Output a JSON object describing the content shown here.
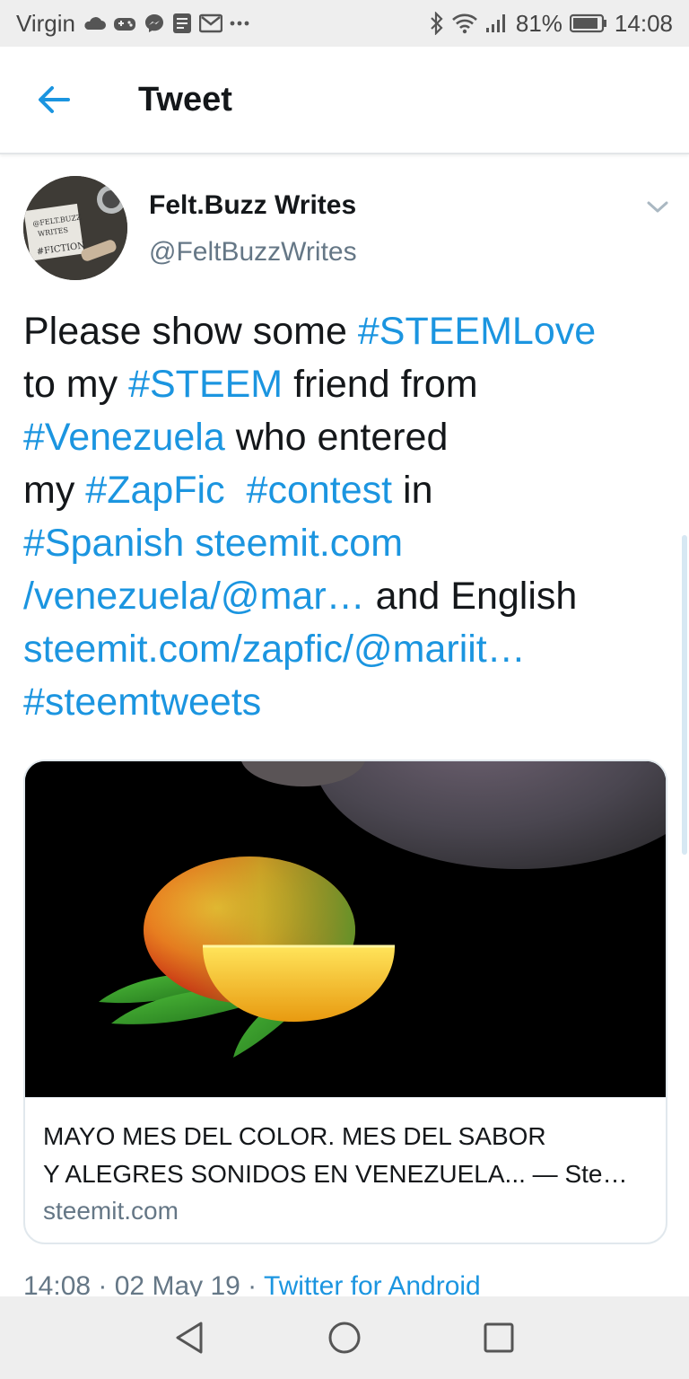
{
  "status_bar": {
    "carrier": "Virgin",
    "battery": "81%",
    "time": "14:08",
    "icons": [
      "cloud-icon",
      "game-controller-icon",
      "messenger-icon",
      "document-icon",
      "gmail-icon",
      "more-dots-icon",
      "bluetooth-icon",
      "wifi-icon",
      "signal-icon",
      "battery-icon"
    ]
  },
  "header": {
    "title": "Tweet",
    "back_icon": "back-arrow-icon"
  },
  "tweet": {
    "author_name": "Felt.Buzz Writes",
    "author_handle": "@FeltBuzzWrites",
    "avatar_text": [
      "@FELT.BUZZ",
      "WRITES",
      "#FICTION"
    ],
    "text_lines": [
      [
        {
          "t": "Please show some ",
          "tag": false
        },
        {
          "t": "#STEEMLove",
          "tag": true
        }
      ],
      [
        {
          "t": "to my ",
          "tag": false
        },
        {
          "t": "#STEEM",
          "tag": true
        },
        {
          "t": " friend from",
          "tag": false
        }
      ],
      [
        {
          "t": "#Venezuela",
          "tag": true
        },
        {
          "t": " who entered",
          "tag": false
        }
      ],
      [
        {
          "t": "my ",
          "tag": false
        },
        {
          "t": "#ZapFic",
          "tag": true
        },
        {
          "t": "  ",
          "tag": false
        },
        {
          "t": "#contest",
          "tag": true
        },
        {
          "t": " in",
          "tag": false
        }
      ],
      [
        {
          "t": "#Spanish",
          "tag": true
        },
        {
          "t": " ",
          "tag": false
        },
        {
          "t": "steemit.com",
          "tag": true
        }
      ],
      [
        {
          "t": "/venezuela/@mar…",
          "tag": true
        },
        {
          "t": " and English",
          "tag": false
        }
      ],
      [
        {
          "t": "steemit.com/zapfic/@mariit…",
          "tag": true
        }
      ],
      [
        {
          "t": "#steemtweets",
          "tag": true
        }
      ]
    ],
    "card": {
      "title_lines": [
        "MAYO MES DEL COLOR. MES DEL SABOR",
        "Y ALEGRES SONIDOS EN VENEZUELA... — Ste…"
      ],
      "domain": "steemit.com"
    },
    "meta": {
      "time": "14:08",
      "date": "02 May 19",
      "source": "Twitter for Android",
      "separator": " · "
    }
  },
  "colors": {
    "link": "#1b95e0",
    "text": "#14171a",
    "secondary": "#657786",
    "system_bar": "#eeeeee"
  }
}
